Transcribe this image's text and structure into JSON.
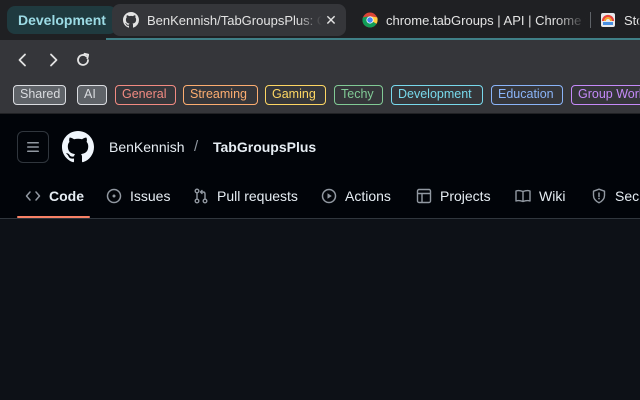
{
  "tabstrip": {
    "group_label": "Development",
    "tabs": [
      {
        "title": "BenKennish/TabGroupsPlus: Chrome extension",
        "icon": "github-icon"
      },
      {
        "title": "chrome.tabGroups  |  API  |  Chrome for Developers",
        "icon": "chrome-icon"
      },
      {
        "title": "Sto",
        "icon": "app-icon"
      }
    ],
    "close_glyph": "✕"
  },
  "toolbar": {
    "back": "back-arrow-icon",
    "forward": "forward-arrow-icon",
    "reload": "reload-icon"
  },
  "bookmarks": [
    {
      "label": "Shared",
      "color": "#dadce0",
      "fill": "#5f6368"
    },
    {
      "label": "AI",
      "color": "#dadce0",
      "fill": "#5f6368"
    },
    {
      "label": "General",
      "color": "#f28b82",
      "fill": "transparent"
    },
    {
      "label": "Streaming",
      "color": "#fcad70",
      "fill": "transparent"
    },
    {
      "label": "Gaming",
      "color": "#fdd663",
      "fill": "transparent"
    },
    {
      "label": "Techy",
      "color": "#81c995",
      "fill": "transparent"
    },
    {
      "label": "Development",
      "color": "#78d9ec",
      "fill": "transparent"
    },
    {
      "label": "Education",
      "color": "#8ab4f8",
      "fill": "transparent"
    },
    {
      "label": "Group Work",
      "color": "#c58af9",
      "fill": "transparent"
    }
  ],
  "github": {
    "owner": "BenKennish",
    "separator": "/",
    "repo": "TabGroupsPlus",
    "tabs": [
      {
        "label": "Code",
        "icon": "code-icon"
      },
      {
        "label": "Issues",
        "icon": "issue-icon"
      },
      {
        "label": "Pull requests",
        "icon": "pull-request-icon"
      },
      {
        "label": "Actions",
        "icon": "play-icon"
      },
      {
        "label": "Projects",
        "icon": "table-icon"
      },
      {
        "label": "Wiki",
        "icon": "book-icon"
      },
      {
        "label": "Security",
        "icon": "shield-icon"
      }
    ],
    "accent": "#f78166"
  },
  "colors": {
    "tab_group": "#78d9ec",
    "page_bg": "#0d1117",
    "header_bg": "#010409"
  }
}
